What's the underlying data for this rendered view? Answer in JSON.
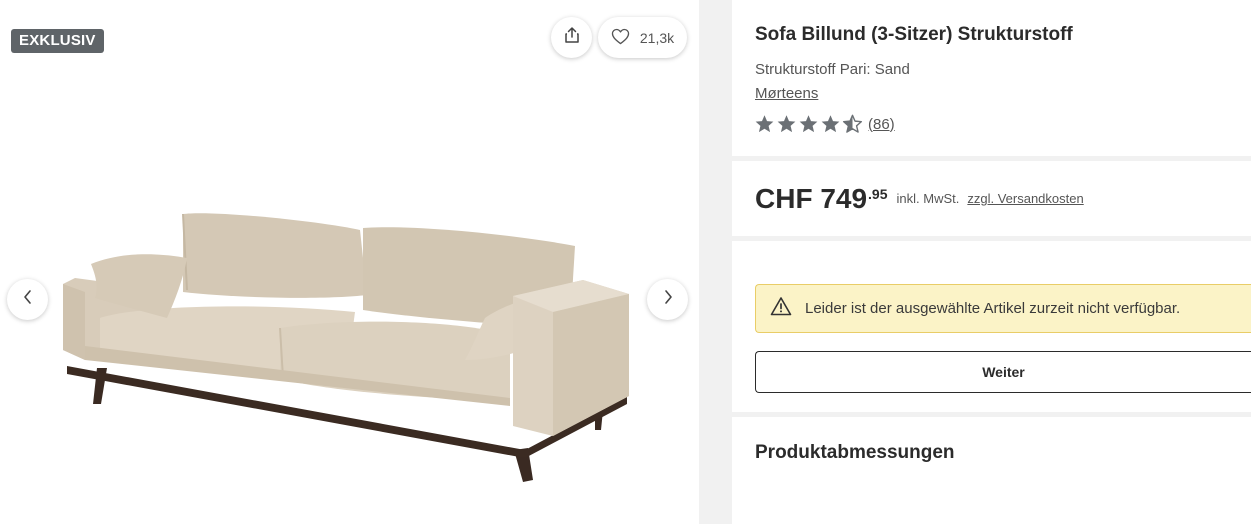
{
  "gallery": {
    "badge": "EXKLUSIV",
    "favorites_count": "21,3k",
    "icons": {
      "share": "share-icon",
      "favorite": "heart-icon",
      "prev": "chevron-left-icon",
      "next": "chevron-right-icon"
    }
  },
  "product": {
    "title": "Sofa Billund (3-Sitzer) Strukturstoff",
    "variant": "Strukturstoff Pari: Sand",
    "brand": "Mørteens",
    "rating": 4.5,
    "review_count": "(86)"
  },
  "price": {
    "main": "CHF 749",
    "cents": ".95",
    "tax_note": "inkl. MwSt.",
    "shipping_link": "zzgl. Versandkosten"
  },
  "availability": {
    "message": "Leider ist der ausgewählte Artikel zurzeit nicht verfügbar.",
    "button_label": "Weiter",
    "icon": "warning-icon"
  },
  "dimensions": {
    "title": "Produktabmessungen"
  },
  "colors": {
    "badge_bg": "#5f6468",
    "alert_bg": "#fbf3c7",
    "alert_border": "#e9cd67",
    "star": "#6b7075",
    "sofa_fabric": "#ddd2c1"
  }
}
